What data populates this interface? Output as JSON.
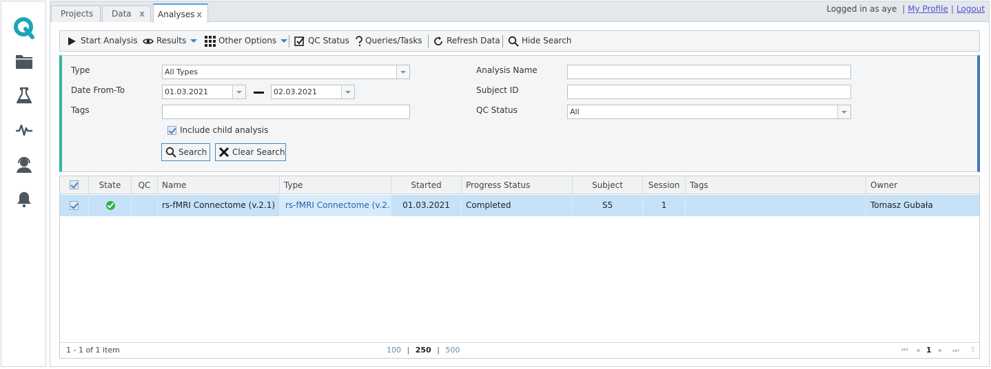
{
  "sidebar": {
    "logo": "q-logo-icon",
    "items": [
      {
        "name": "folder-icon"
      },
      {
        "name": "flask-icon"
      },
      {
        "name": "pulse-icon"
      },
      {
        "name": "support-agent-icon"
      },
      {
        "name": "bell-icon"
      }
    ]
  },
  "tabs": [
    {
      "label": "Projects",
      "closable": false,
      "active": false
    },
    {
      "label": "Data",
      "closable": true,
      "active": false
    },
    {
      "label": "Analyses",
      "closable": true,
      "active": true
    }
  ],
  "tab_close_glyph": "x",
  "user": {
    "prefix": "Logged in as",
    "username": "aye",
    "profile_link": "My Profile",
    "separator": "|",
    "logout_link": "Logout"
  },
  "toolbar": {
    "start_analysis": "Start Analysis",
    "results": "Results",
    "other_options": "Other Options",
    "qc_status": "QC Status",
    "queries_tasks": "Queries/Tasks",
    "refresh_data": "Refresh Data",
    "hide_search": "Hide Search"
  },
  "search": {
    "type_label": "Type",
    "type_value": "All Types",
    "date_label": "Date From-To",
    "date_from": "01.03.2021",
    "date_to": "02.03.2021",
    "tags_label": "Tags",
    "tags_value": "",
    "include_child_label": "Include child analysis",
    "include_child_checked": true,
    "search_button": "Search",
    "clear_button": "Clear Search",
    "analysis_name_label": "Analysis Name",
    "analysis_name_value": "",
    "subject_id_label": "Subject ID",
    "subject_id_value": "",
    "qc_status_label": "QC Status",
    "qc_status_value": "All"
  },
  "grid": {
    "columns": [
      "State",
      "QC",
      "Name",
      "Type",
      "Started",
      "Progress Status",
      "Subject",
      "Session",
      "Tags",
      "Owner"
    ],
    "rows": [
      {
        "selected": true,
        "state": "success",
        "qc": "",
        "name": "rs-fMRI Connectome (v.2.1)",
        "type": "rs-fMRI Connectome (v.2....",
        "started": "01.03.2021",
        "progress_status": "Completed",
        "subject": "S5",
        "session": "1",
        "tags": "",
        "owner": "Tomasz Gubała"
      }
    ],
    "footer": {
      "item_count": "1 - 1 of 1 item",
      "page_sizes": [
        "100",
        "250",
        "500"
      ],
      "active_page_size": "250",
      "current_page": "1"
    }
  },
  "colors": {
    "accent_green": "#37b59a",
    "accent_blue": "#4176b8",
    "row_selected": "#c6e2f8",
    "link": "#5a4fcf",
    "logo": "#1aa6b7"
  }
}
